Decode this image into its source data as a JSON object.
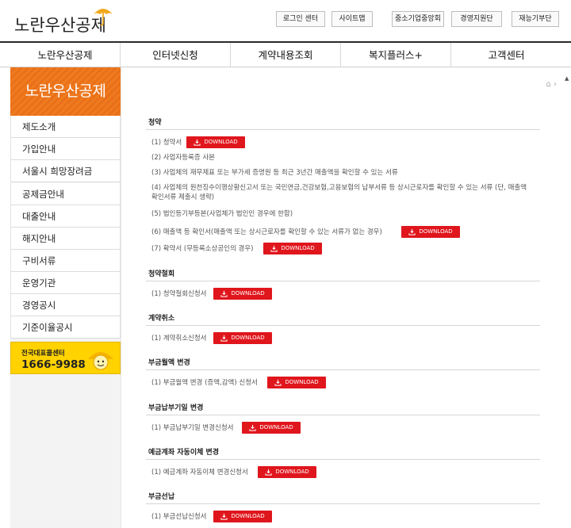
{
  "logo": {
    "name": "노란우산공제"
  },
  "top_links": [
    "로그인 센터",
    "사이트맵",
    "중소기업중앙회",
    "경영지원단",
    "재능기부단"
  ],
  "gnb": [
    "노란우산공제",
    "인터넷신청",
    "계약내용조회",
    "복지플러스+",
    "고객센터"
  ],
  "sidebar": {
    "title": "노란우산공제",
    "items": [
      "제도소개",
      "가입안내",
      "서울시 희망장려금",
      "공제금안내",
      "대출안내",
      "해지안내",
      "구비서류",
      "운영기관",
      "경영공시",
      "기준이율공시"
    ],
    "call": {
      "label": "전국대표콜센터",
      "number": "1666-9988"
    }
  },
  "download_label": "DOWNLOAD",
  "sections": [
    {
      "title": "청약",
      "rows": [
        {
          "text": "(1) 청약서",
          "download": true
        },
        {
          "text": "(2) 사업자등록증 사본",
          "download": false
        },
        {
          "text": "(3) 사업체의 재무제표 또는 부가세 증명원 등 최근 3년간 매출액을 확인할 수 있는 서류",
          "download": false
        },
        {
          "text": "(4) 사업체의 원천징수이행상황신고서 또는 국민연금,건강보험,고용보험의 납부서류 등 상시근로자를 확인할 수 있는 서류 (단, 매출액 확인서류 제출시 생략)",
          "download": false
        },
        {
          "text": "(5) 법인등기부등본(사업체가 법인인 경우에 한함)",
          "download": false
        },
        {
          "text": "(6) 매출액 등 확인서(매출액 또는 상시근로자를 확인할 수 있는 서류가 없는 경우)",
          "download": true
        },
        {
          "text": "(7) 확약서 (무등록소상공인의 경우)",
          "download": true
        }
      ]
    },
    {
      "title": "청약철회",
      "rows": [
        {
          "text": "(1) 청약철회신청서",
          "download": true
        }
      ]
    },
    {
      "title": "계약취소",
      "rows": [
        {
          "text": "(1) 계약취소신청서",
          "download": true
        }
      ]
    },
    {
      "title": "부금월액 변경",
      "rows": [
        {
          "text": "(1) 부금월액 변경 (증액,감액) 신청서",
          "download": true
        }
      ]
    },
    {
      "title": "부금납부기일 변경",
      "rows": [
        {
          "text": "(1) 부금납부기일 변경신청서",
          "download": true
        }
      ]
    },
    {
      "title": "예금계좌 자동이체 변경",
      "rows": [
        {
          "text": "(1) 예금계좌 자동이체 변경신청서",
          "download": true
        }
      ]
    },
    {
      "title": "부금선납",
      "rows": [
        {
          "text": "(1) 부금선납신청서",
          "download": true
        }
      ]
    }
  ],
  "colors": {
    "accent_orange": "#f07a1e",
    "download_red": "#e0161d",
    "callbox_yellow": "#ffd200"
  }
}
